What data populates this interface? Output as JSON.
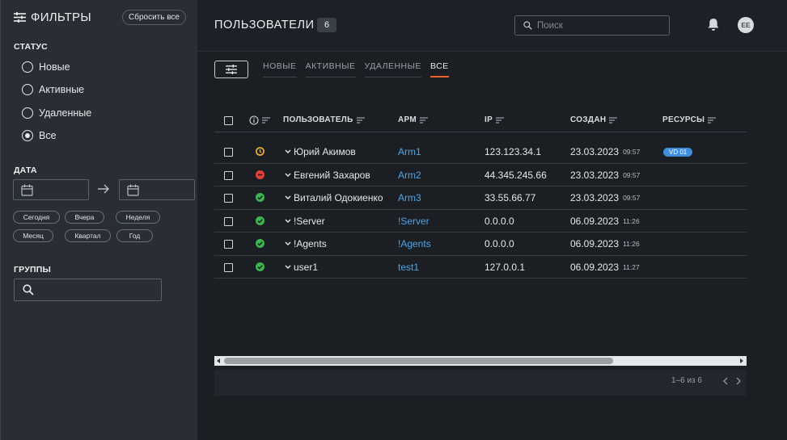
{
  "sidebar": {
    "title": "ФИЛЬТРЫ",
    "reset_label": "Сбросить все",
    "status_label": "СТАТУС",
    "status_options": [
      {
        "label": "Новые",
        "selected": false
      },
      {
        "label": "Активные",
        "selected": false
      },
      {
        "label": "Удаленные",
        "selected": false
      },
      {
        "label": "Все",
        "selected": true
      }
    ],
    "date_label": "ДАТА",
    "date_presets": [
      "Сегодня",
      "Вчера",
      "Неделя",
      "Месяц",
      "Квартал",
      "Год"
    ],
    "groups_label": "ГРУППЫ"
  },
  "header": {
    "title": "ПОЛЬЗОВАТЕЛИ",
    "count": "6",
    "search_placeholder": "Поиск",
    "avatar_initials": "EE"
  },
  "tabs": [
    {
      "label": "НОВЫЕ",
      "active": false
    },
    {
      "label": "АКТИВНЫЕ",
      "active": false
    },
    {
      "label": "УДАЛЕННЫЕ",
      "active": false
    },
    {
      "label": "ВСЕ",
      "active": true
    }
  ],
  "table": {
    "columns": {
      "user": "ПОЛЬЗОВАТЕЛЬ",
      "arm": "АРМ",
      "ip": "IP",
      "created": "СОЗДАН",
      "resources": "РЕСУРСЫ"
    },
    "rows": [
      {
        "status": "pending",
        "user": "Юрий Акимов",
        "arm": "Arm1",
        "ip": "123.123.34.1",
        "date": "23.03.2023",
        "time": "09:57",
        "resource": "VD 01"
      },
      {
        "status": "blocked",
        "user": "Евгений Захаров",
        "arm": "Arm2",
        "ip": "44.345.245.66",
        "date": "23.03.2023",
        "time": "09:57",
        "resource": ""
      },
      {
        "status": "ok",
        "user": "Виталий Одокиенко",
        "arm": "Arm3",
        "ip": "33.55.66.77",
        "date": "23.03.2023",
        "time": "09:57",
        "resource": ""
      },
      {
        "status": "ok",
        "user": "!Server",
        "arm": "!Server",
        "ip": "0.0.0.0",
        "date": "06.09.2023",
        "time": "11:26",
        "resource": ""
      },
      {
        "status": "ok",
        "user": "!Agents",
        "arm": "!Agents",
        "ip": "0.0.0.0",
        "date": "06.09.2023",
        "time": "11:26",
        "resource": ""
      },
      {
        "status": "ok",
        "user": "user1",
        "arm": "test1",
        "ip": "127.0.0.1",
        "date": "06.09.2023",
        "time": "11:27",
        "resource": ""
      }
    ]
  },
  "pagination": {
    "text": "1–6 из 6"
  },
  "colors": {
    "accent": "#e8622c",
    "link": "#4ea6e8",
    "ok": "#3fb552",
    "blocked": "#e2413a",
    "pending": "#f0b43a"
  }
}
